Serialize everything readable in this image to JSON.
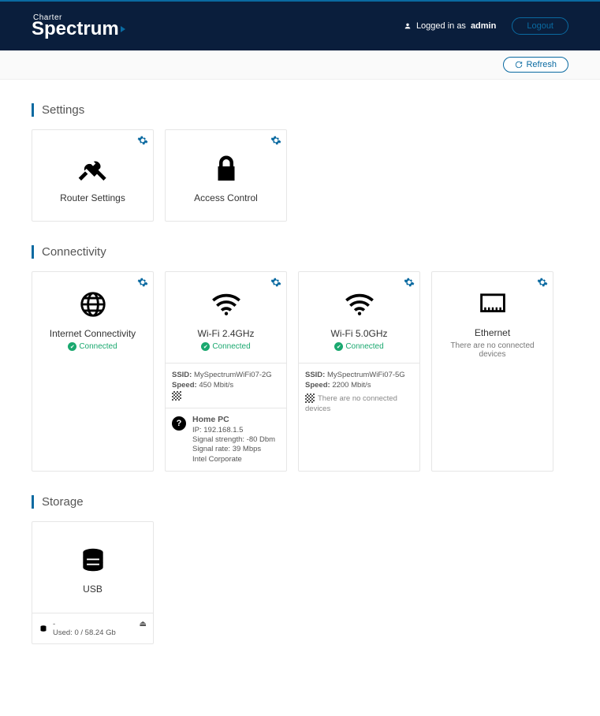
{
  "header": {
    "logo_top": "Charter",
    "logo_bottom": "Spectrum",
    "login_prefix": "Logged in as ",
    "login_user": "admin",
    "logout_label": "Logout"
  },
  "subbar": {
    "refresh_label": "Refresh"
  },
  "sections": {
    "settings": {
      "title": "Settings",
      "router": "Router Settings",
      "access": "Access Control"
    },
    "connectivity": {
      "title": "Connectivity",
      "internet": {
        "title": "Internet Connectivity",
        "status": "Connected"
      },
      "wifi24": {
        "title": "Wi-Fi 2.4GHz",
        "status": "Connected",
        "ssid_label": "SSID:",
        "ssid": "MySpectrumWiFi07-2G",
        "speed_label": "Speed:",
        "speed": "450 Mbit/s",
        "device": {
          "name": "Home PC",
          "ip_label": "IP:",
          "ip": "192.168.1.5",
          "signal_strength": "Signal strength: -80 Dbm",
          "signal_rate": "Signal rate: 39 Mbps",
          "vendor": "Intel Corporate"
        }
      },
      "wifi5": {
        "title": "Wi-Fi 5.0GHz",
        "status": "Connected",
        "ssid_label": "SSID:",
        "ssid": "MySpectrumWiFi07-5G",
        "speed_label": "Speed:",
        "speed": "2200 Mbit/s",
        "no_devices": "There are no connected devices"
      },
      "ethernet": {
        "title": "Ethernet",
        "no_devices": "There are no connected devices"
      }
    },
    "storage": {
      "title": "Storage",
      "usb": {
        "title": "USB",
        "name": "-",
        "used": "Used: 0 / 58.24 Gb"
      }
    }
  }
}
